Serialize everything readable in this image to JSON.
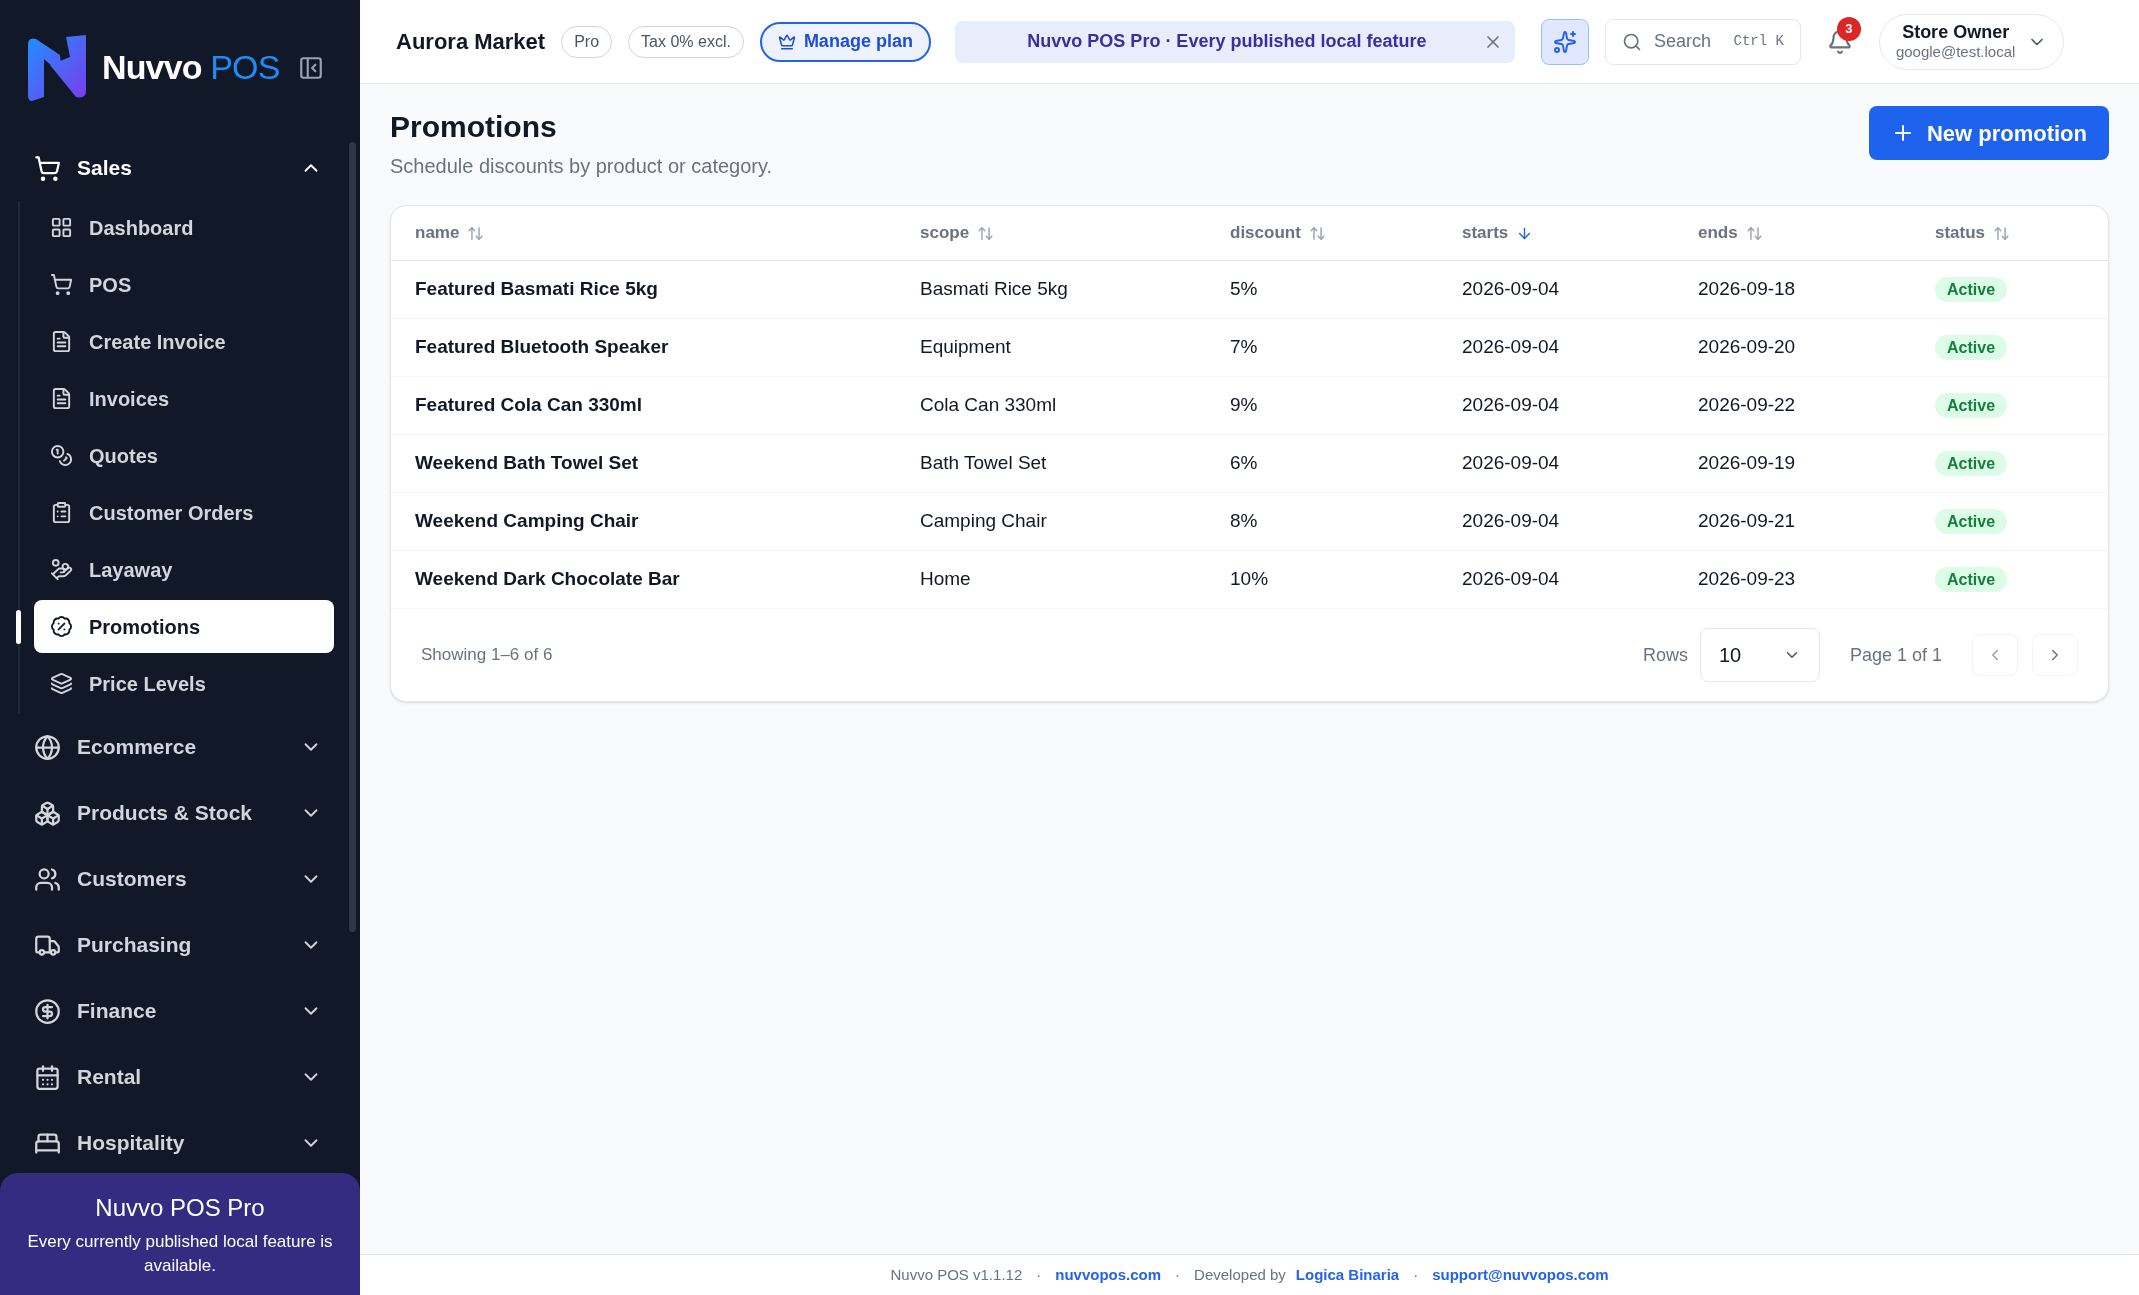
{
  "sidebar": {
    "logo": {
      "word": "Nuvvo",
      "accent": "POS"
    },
    "groups": [
      {
        "label": "Sales",
        "expanded": true,
        "items": [
          {
            "label": "Dashboard",
            "selected": false
          },
          {
            "label": "POS",
            "selected": false
          },
          {
            "label": "Create Invoice",
            "selected": false
          },
          {
            "label": "Invoices",
            "selected": false
          },
          {
            "label": "Quotes",
            "selected": false
          },
          {
            "label": "Customer Orders",
            "selected": false
          },
          {
            "label": "Layaway",
            "selected": false
          },
          {
            "label": "Promotions",
            "selected": true
          },
          {
            "label": "Price Levels",
            "selected": false
          }
        ]
      },
      {
        "label": "Ecommerce",
        "expanded": false
      },
      {
        "label": "Products & Stock",
        "expanded": false
      },
      {
        "label": "Customers",
        "expanded": false
      },
      {
        "label": "Purchasing",
        "expanded": false
      },
      {
        "label": "Finance",
        "expanded": false
      },
      {
        "label": "Rental",
        "expanded": false
      },
      {
        "label": "Hospitality",
        "expanded": false
      }
    ],
    "promo": {
      "title": "Nuvvo POS Pro",
      "text": "Every currently published local feature is available."
    }
  },
  "topbar": {
    "store": "Aurora Market",
    "plan_badge": "Pro",
    "tax_badge": "Tax 0% excl.",
    "manage_button": "Manage plan",
    "banner": "Nuvvo POS Pro · Every published local feature",
    "search": {
      "placeholder": "Search",
      "shortcut": "Ctrl K"
    },
    "notifications": "3",
    "user": {
      "name": "Store Owner",
      "email": "google@test.local"
    }
  },
  "page": {
    "title": "Promotions",
    "subtitle": "Schedule discounts by product or category.",
    "new_button": "New promotion"
  },
  "table": {
    "columns": [
      {
        "label": "name",
        "sorted": false
      },
      {
        "label": "scope",
        "sorted": false
      },
      {
        "label": "discount",
        "sorted": false
      },
      {
        "label": "starts",
        "sorted": true
      },
      {
        "label": "ends",
        "sorted": false
      },
      {
        "label": "status",
        "sorted": false
      }
    ],
    "rows": [
      [
        "Featured Basmati Rice 5kg",
        "Basmati Rice 5kg",
        "5%",
        "2026-09-04",
        "2026-09-18",
        "Active"
      ],
      [
        "Featured Bluetooth Speaker",
        "Equipment",
        "7%",
        "2026-09-04",
        "2026-09-20",
        "Active"
      ],
      [
        "Featured Cola Can 330ml",
        "Cola Can 330ml",
        "9%",
        "2026-09-04",
        "2026-09-22",
        "Active"
      ],
      [
        "Weekend Bath Towel Set",
        "Bath Towel Set",
        "6%",
        "2026-09-04",
        "2026-09-19",
        "Active"
      ],
      [
        "Weekend Camping Chair",
        "Camping Chair",
        "8%",
        "2026-09-04",
        "2026-09-21",
        "Active"
      ],
      [
        "Weekend Dark Chocolate Bar",
        "Home",
        "10%",
        "2026-09-04",
        "2026-09-23",
        "Active"
      ]
    ],
    "footer": {
      "showing": "Showing 1–6 of 6",
      "rows_label": "Rows",
      "rows_value": "10",
      "page": "Page 1 of 1"
    }
  },
  "footer": [
    {
      "kind": "text",
      "text": "Nuvvo POS v1.1.12"
    },
    {
      "kind": "sep",
      "text": "·"
    },
    {
      "kind": "link",
      "text": "nuvvopos.com"
    },
    {
      "kind": "sep",
      "text": "·"
    },
    {
      "kind": "text",
      "text": "Developed by"
    },
    {
      "kind": "link",
      "text": "Logica Binaria"
    },
    {
      "kind": "sep",
      "text": "·"
    },
    {
      "kind": "link",
      "text": "support@nuvvopos.com"
    }
  ]
}
